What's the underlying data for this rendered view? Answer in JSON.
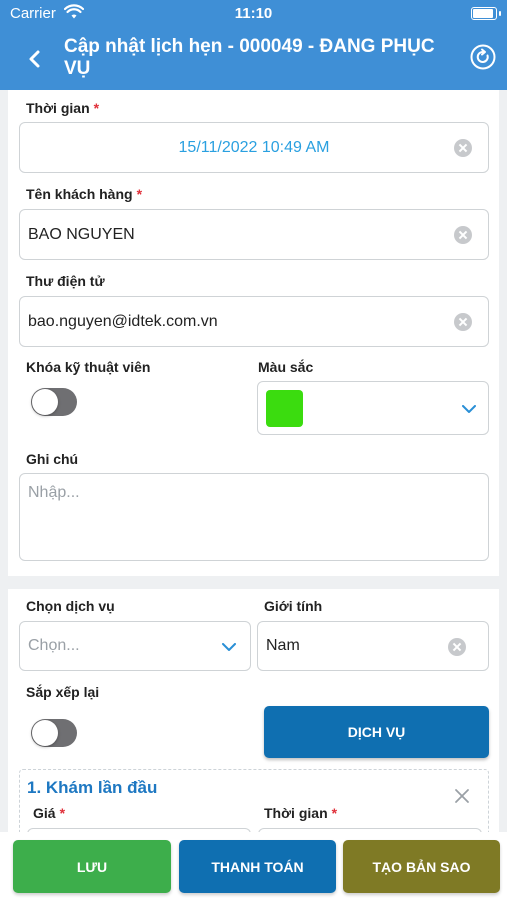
{
  "status_bar": {
    "carrier": "Carrier",
    "time": "11:10"
  },
  "header": {
    "title": "Cập nhật lịch hẹn - 000049 - ĐANG PHỤC VỤ",
    "back_icon": "chevron-left-icon",
    "refresh_icon": "refresh-icon"
  },
  "form": {
    "time": {
      "label": "Thời gian",
      "required": "*",
      "value": "15/11/2022 10:49 AM"
    },
    "customer_name": {
      "label": "Tên khách hàng",
      "required": "*",
      "value": "BAO NGUYEN"
    },
    "email": {
      "label": "Thư điện tử",
      "value": "bao.nguyen@idtek.com.vn"
    },
    "lock_technician": {
      "label": "Khóa kỹ thuật viên",
      "on": false
    },
    "color": {
      "label": "Màu sắc",
      "value": "#3bdc0f"
    },
    "note": {
      "label": "Ghi chú",
      "placeholder": "Nhập..."
    }
  },
  "services_section": {
    "choose_service": {
      "label": "Chọn dịch vụ",
      "placeholder": "Chọn..."
    },
    "gender": {
      "label": "Giới tính",
      "value": "Nam"
    },
    "reorder": {
      "label": "Sắp xếp lại",
      "on": false
    },
    "service_button": "DỊCH VỤ",
    "items": [
      {
        "title": "1. Khám lần đầu",
        "price_label": "Giá",
        "time_label": "Thời gian",
        "required": "*"
      }
    ]
  },
  "footer": {
    "save": "LƯU",
    "pay": "THANH TOÁN",
    "duplicate": "TẠO BẢN SAO"
  },
  "colors": {
    "header": "#3f8fd6",
    "primary_button": "#0f6fb1",
    "save_button": "#3dae4b",
    "duplicate_button": "#7f7a25",
    "accent_text": "#1e78c2",
    "date_text": "#2aa0e0"
  }
}
